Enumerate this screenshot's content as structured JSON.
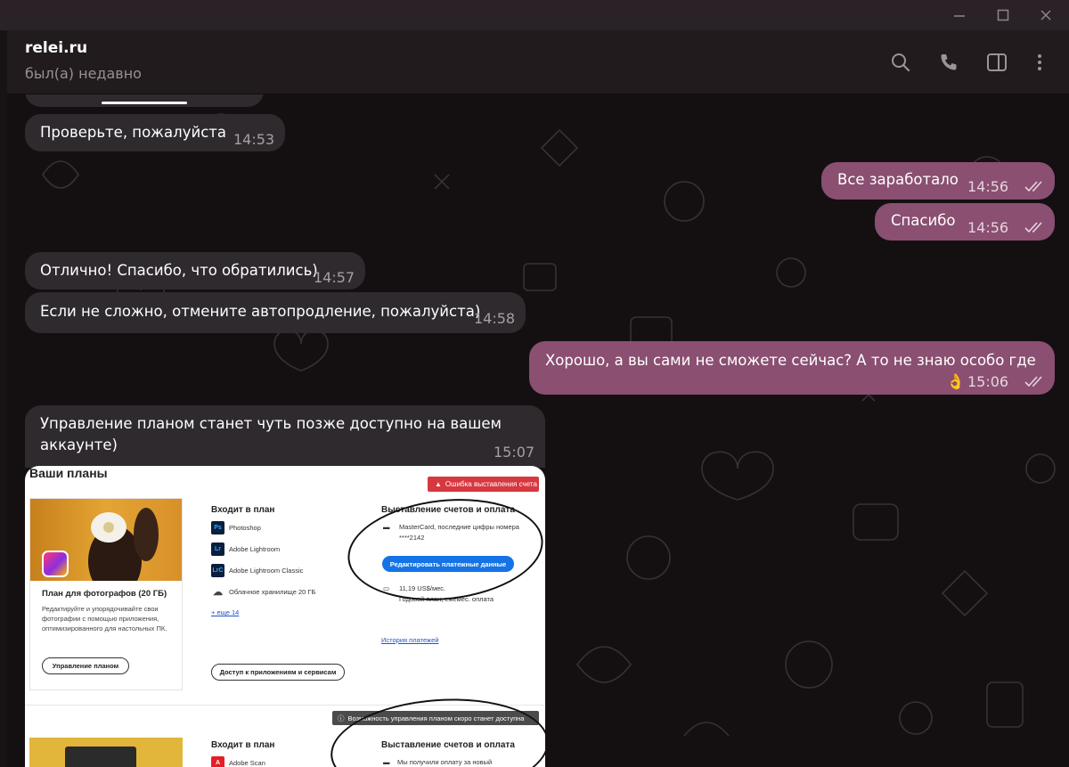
{
  "window": {
    "minimize": "—",
    "maximize": "☐",
    "close": "✕"
  },
  "header": {
    "title": "relei.ru",
    "status": "был(а) недавно"
  },
  "icons": {
    "search": "search-icon",
    "call": "phone-icon",
    "sidebar": "sidebar-toggle-icon",
    "more": "more-vertical-icon"
  },
  "messages": [
    {
      "dir": "in",
      "text": "Проверьте, пожалуйста",
      "time": "14:53"
    },
    {
      "dir": "out",
      "text": "Все заработало",
      "time": "14:56"
    },
    {
      "dir": "out",
      "text": "Спасибо",
      "time": "14:56"
    },
    {
      "dir": "in",
      "text": "Отлично! Спасибо, что обратились)",
      "time": "14:57"
    },
    {
      "dir": "in",
      "text": "Если не сложно, отмените автопродление, пожалуйста)",
      "time": "14:58"
    },
    {
      "dir": "out",
      "text_line1": "Хорошо, а вы сами не сможете сейчас? А то не знаю особо где",
      "emoji": "👌",
      "time": "15:06"
    },
    {
      "dir": "in",
      "text_line1": "Управление планом станет чуть позже доступно на вашем",
      "text_line2": "аккаунте)",
      "time": "15:07"
    }
  ],
  "screenshot": {
    "heading": "Ваши планы",
    "error_badge": "Ошибка выставления счета",
    "plan_title": "План для фотографов (20 ГБ)",
    "plan_desc": "Редактируйте и упорядочивайте свои фотографии с помощью приложения, оптимизированного для настольных ПК.",
    "manage_button": "Управление планом",
    "includes_heading": "Входит в план",
    "apps": [
      {
        "badge": "Ps",
        "name": "Photoshop"
      },
      {
        "badge": "Lr",
        "name": "Adobe Lightroom"
      },
      {
        "badge": "LrC",
        "name": "Adobe Lightroom Classic"
      },
      {
        "badge": "☁",
        "name": "Облачное хранилище 20 ГБ"
      }
    ],
    "more_link": "+ еще 14",
    "access_button": "Доступ к приложениям и сервисам",
    "billing_heading": "Выставление счетов и оплата",
    "card_line1": "MasterCard, последние цифры номера",
    "card_line2": "****2142",
    "edit_payment_button": "Редактировать платежные данные",
    "price": "11,19 US$/мес.",
    "plan_period": "Годовой план, ежемес. оплата",
    "history_link": "История платежей",
    "tooltip": "Возможность управления планом скоро станет доступна",
    "includes_heading_2": "Входит в план",
    "app_2": "Adobe Scan",
    "billing_heading_2": "Выставление счетов и оплата",
    "payment_note": "Мы получили оплату за новый"
  }
}
